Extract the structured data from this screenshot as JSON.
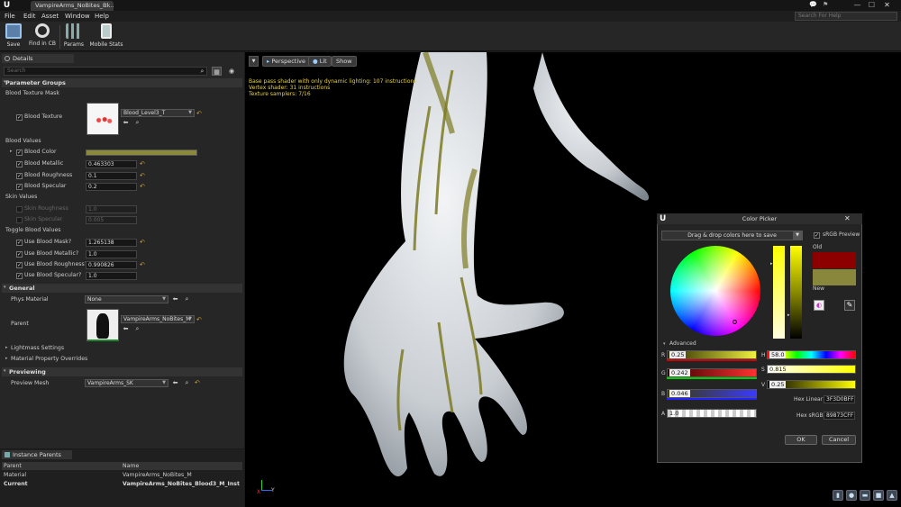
{
  "window": {
    "tab_title": "VampireArms_NoBites_Bl...",
    "tab_close": "×",
    "minimize": "—",
    "maximize": "☐",
    "close": "✕"
  },
  "menu": [
    "File",
    "Edit",
    "Asset",
    "Window",
    "Help"
  ],
  "help_search": {
    "placeholder": "Search For Help"
  },
  "toolbar": [
    {
      "label": "Save",
      "icon": "floppy-icon"
    },
    {
      "label": "Find in CB",
      "icon": "magnifier-icon"
    },
    {
      "label": "Params",
      "icon": "params-icon"
    },
    {
      "label": "Mobile Stats",
      "icon": "mobile-stats-icon"
    }
  ],
  "details": {
    "tab": "Details",
    "search_placeholder": "Search",
    "parameter_groups": "Parameter Groups",
    "blood_texture_mask": {
      "group": "Blood Texture Mask",
      "label": "Blood Texture",
      "value": "Blood_Level3_T"
    },
    "blood_values": {
      "group": "Blood Values",
      "rows": [
        {
          "label": "Blood Color",
          "value": ""
        },
        {
          "label": "Blood Metallic",
          "value": "0.463303"
        },
        {
          "label": "Blood Roughness",
          "value": "0.1"
        },
        {
          "label": "Blood Specular",
          "value": "0.2"
        }
      ],
      "blood_color": "#8b8a3a"
    },
    "skin_values": {
      "group": "Skin Values",
      "rows": [
        {
          "label": "Skin Roughness",
          "value": "1.0"
        },
        {
          "label": "Skin Specular",
          "value": "0.005"
        }
      ]
    },
    "toggle_blood_values": {
      "group": "Toggle Blood Values",
      "rows": [
        {
          "label": "Use Blood Mask?",
          "value": "1.265138"
        },
        {
          "label": "Use Blood Metallic?",
          "value": "1.0"
        },
        {
          "label": "Use Blood Roughness?",
          "value": "0.990826"
        },
        {
          "label": "Use Blood Specular?",
          "value": "1.0"
        }
      ]
    },
    "general": {
      "title": "General",
      "phys_material_label": "Phys Material",
      "phys_material_value": "None",
      "parent_label": "Parent",
      "parent_value": "VampireArms_NoBites_M",
      "lightmass": "Lightmass Settings",
      "overrides": "Material Property Overrides"
    },
    "previewing": {
      "title": "Previewing",
      "label": "Preview Mesh",
      "value": "VampireArms_SK"
    }
  },
  "instance_parents": {
    "tab": "Instance Parents",
    "headers": [
      "Parent",
      "Name"
    ],
    "rows": [
      {
        "parent": "Material",
        "name": "VampireArms_NoBites_M"
      },
      {
        "parent": "Current",
        "name": "VampireArms_NoBites_Blood3_M_Inst"
      }
    ]
  },
  "viewport": {
    "buttons": [
      "Perspective",
      "Lit",
      "Show"
    ],
    "stats": [
      "Base pass shader with only dynamic lighting: 107 instructions",
      "Vertex shader: 31 instructions",
      "Texture samplers: 7/16"
    ],
    "axis_x": "X",
    "axis_y": "Y"
  },
  "color_picker": {
    "title": "Color Picker",
    "close": "✕",
    "drag_drop": "Drag & drop colors here to save",
    "srgb_preview": "sRGB Preview",
    "old_label": "Old",
    "new_label": "New",
    "advanced": "Advanced",
    "old_color": "#8c0000",
    "new_color": "#89873c",
    "r": {
      "label": "R",
      "value": "0.25"
    },
    "g": {
      "label": "G",
      "value": "0.242"
    },
    "b": {
      "label": "B",
      "value": "0.046"
    },
    "a": {
      "label": "A",
      "value": "1.0"
    },
    "h": {
      "label": "H",
      "value": "58.0"
    },
    "s": {
      "label": "S",
      "value": "0.815"
    },
    "v": {
      "label": "V",
      "value": "0.25"
    },
    "hex_linear_label": "Hex Linear",
    "hex_linear": "3F3D0BFF",
    "hex_srgb_label": "Hex sRGB",
    "hex_srgb": "89873CFF",
    "ok": "OK",
    "cancel": "Cancel"
  }
}
